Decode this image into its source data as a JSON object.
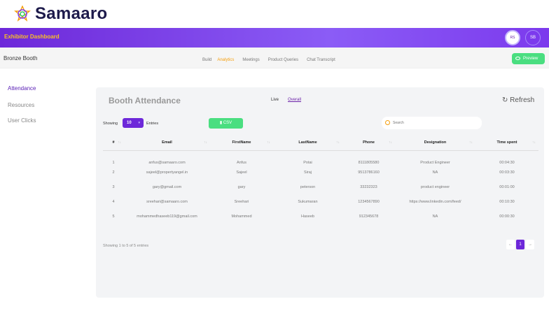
{
  "brand": {
    "name": "Samaaro"
  },
  "topbar": {
    "title": "Exhibitor Dashboard",
    "avatar1": "RS",
    "avatar2": "SB"
  },
  "subnav": {
    "booth_name": "Bronze Booth",
    "tabs": [
      "Build",
      "Analytics",
      "Meetings",
      "Product Queries",
      "Chat Transcript"
    ],
    "active_tab": "Analytics",
    "preview_label": "Preview"
  },
  "sidebar": {
    "items": [
      {
        "label": "Attendance",
        "active": true
      },
      {
        "label": "Resources",
        "active": false
      },
      {
        "label": "User Clicks",
        "active": false
      }
    ]
  },
  "panel": {
    "title": "Booth Attendance",
    "live_label": "Live",
    "overall_label": "Overall",
    "refresh_label": "Refresh",
    "showing_label": "Showing",
    "page_size": "10",
    "entries_label": "Entries",
    "csv_label": "CSV",
    "search_placeholder": "Search"
  },
  "table": {
    "columns": [
      "#",
      "Email",
      "FirstName",
      "LastName",
      "Phone",
      "Designation",
      "Time spent"
    ],
    "rows": [
      [
        "1",
        "anfus@samaaro.com",
        "Anfus",
        "Potai",
        "8111805580",
        "Product Engineer",
        "00:04:30"
      ],
      [
        "2",
        "sajeel@propertyangel.in",
        "Sajeel",
        "Siraj",
        "9513786160",
        "NA",
        "00:03:30"
      ],
      [
        "3",
        "gary@gmail.com",
        "gary",
        "peterson",
        "33232323",
        "product engineer",
        "00:01:00"
      ],
      [
        "4",
        "sreehari@samaaro.com",
        "Sreehari",
        "Sukumaran",
        "1234567890",
        "https://www.linkedin.com/feed/",
        "00:10:30"
      ],
      [
        "5",
        "mohammedhaseeb119@gmail.com",
        "Mohammed",
        "Haseeb",
        "912345678",
        "NA",
        "00:00:30"
      ]
    ]
  },
  "footer": {
    "info": "Showing 1 to 5 of 5 entries",
    "prev": "←",
    "page": "1",
    "next": "→"
  },
  "colors": {
    "brand_purple": "#6d28d9",
    "accent_orange": "#f59e0b",
    "green": "#4ade80"
  }
}
